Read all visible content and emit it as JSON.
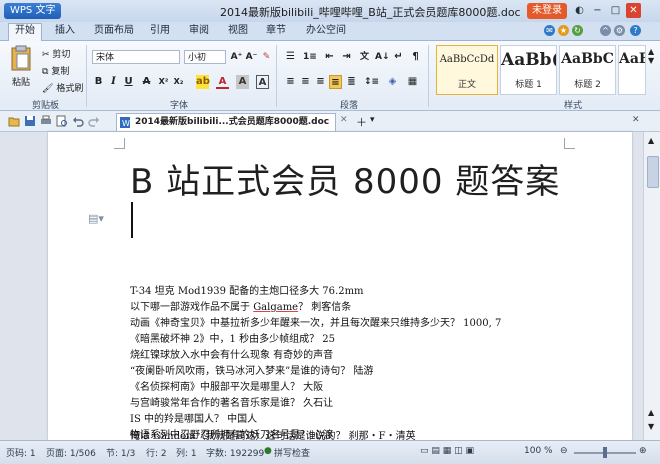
{
  "app": {
    "menu_button": "WPS 文字",
    "doc_title": "2014最新版bilibili_哔哩哔哩_B站_正式会员题库8000题.doc",
    "login_button": "未登录"
  },
  "tabs": [
    "开始",
    "插入",
    "页面布局",
    "引用",
    "审阅",
    "视图",
    "章节",
    "办公空间"
  ],
  "ribbon": {
    "paste": "粘贴",
    "cut": "剪切",
    "copy": "复制",
    "format_painter": "格式刷",
    "clipboard_group": "剪贴板",
    "font_name": "宋体",
    "font_size": "小初",
    "font_group": "字体",
    "paragraph_group": "段落",
    "styles_group": "样式",
    "styles": [
      {
        "sample": "AaBbCcDd",
        "name": "正文"
      },
      {
        "sample": "AaBb(",
        "name": "标题 1"
      },
      {
        "sample": "AaBbC",
        "name": "标题 2"
      },
      {
        "sample": "AaBl",
        "name": ""
      }
    ]
  },
  "doc_tab_label": "2014最新版bilibili...式会员题库8000题.doc",
  "document": {
    "title": "B 站正式会员 8000 题答案",
    "lines": [
      "T-34 坦克 Mod1939 配备的主炮口径多大  76.2mm",
      "以下哪一部游戏作品不属于 Galgame？  刺客信条",
      "动画《神奇宝贝》中基拉祈多少年醒来一次，并且每次醒来只维持多少天？  1000, 7",
      "《暗黑破坏神 2》中，1 秒由多少帧组成？  25",
      "烧红镍球放入水中会有什么现象  有奇妙的声音",
      "“夜阑卧听风吹雨，铁马冰河入梦来”是谁的诗句？  陆游",
      "《名侦探柯南》中服部平次是哪里人？  大阪",
      "与宫崎骏常年合作的著名音乐家是谁？  久石让",
      "IS 中的羚是哪国人？  中国人",
      "物语系列中忍野忍所拥有的妖刀名号是？  心渡",
      "俺は Gandom（我就是高达）这句话是谁说的？  刹那・F・清英"
    ]
  },
  "status": {
    "page_num": "页码: 1",
    "page": "页面: 1/506",
    "section": "节: 1/3",
    "row": "行: 2",
    "col": "列: 1",
    "words": "字数: 192299",
    "spell": "拼写检查",
    "zoom": "100 %"
  }
}
